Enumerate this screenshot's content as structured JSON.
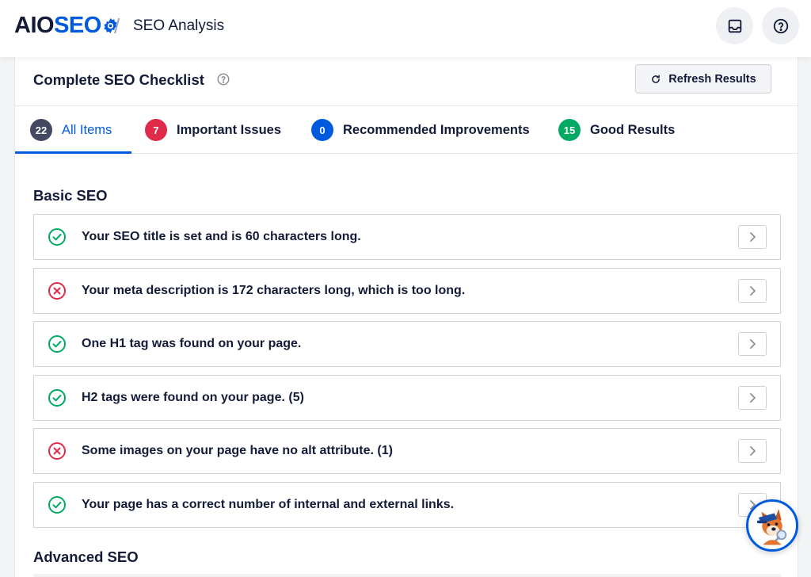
{
  "header": {
    "logo_aio": "AIO",
    "logo_seo": "SEO",
    "breadcrumb_separator": "/",
    "page_title": "SEO Analysis",
    "inbox_icon": "inbox-icon",
    "help_icon": "help-circle-icon"
  },
  "checklist": {
    "title": "Complete SEO Checklist",
    "help_icon": "help-circle-icon",
    "refresh_label": "Refresh Results",
    "refresh_icon": "refresh-icon"
  },
  "tabs": [
    {
      "count": "22",
      "label": "All Items",
      "color": "#434960",
      "active": true
    },
    {
      "count": "7",
      "label": "Important Issues",
      "color": "#df2a4a",
      "active": false
    },
    {
      "count": "0",
      "label": "Recommended Improvements",
      "color": "#005ae0",
      "active": false
    },
    {
      "count": "15",
      "label": "Good Results",
      "color": "#00aa63",
      "active": false
    }
  ],
  "sections": {
    "basic": {
      "title": "Basic SEO",
      "items": [
        {
          "status": "good",
          "text": "Your SEO title is set and is 60 characters long."
        },
        {
          "status": "error",
          "text": "Your meta description is 172 characters long, which is too long."
        },
        {
          "status": "good",
          "text": "One H1 tag was found on your page."
        },
        {
          "status": "good",
          "text": "H2 tags were found on your page. (5)"
        },
        {
          "status": "error",
          "text": "Some images on your page have no alt attribute. (1)"
        },
        {
          "status": "good",
          "text": "Your page has a correct number of internal and external links."
        }
      ]
    },
    "advanced": {
      "title": "Advanced SEO"
    }
  },
  "colors": {
    "accent": "#005ae0",
    "good": "#00aa63",
    "error": "#df2a4a",
    "text": "#141b38"
  },
  "mascot_icon": "aioseo-mascot-icon"
}
